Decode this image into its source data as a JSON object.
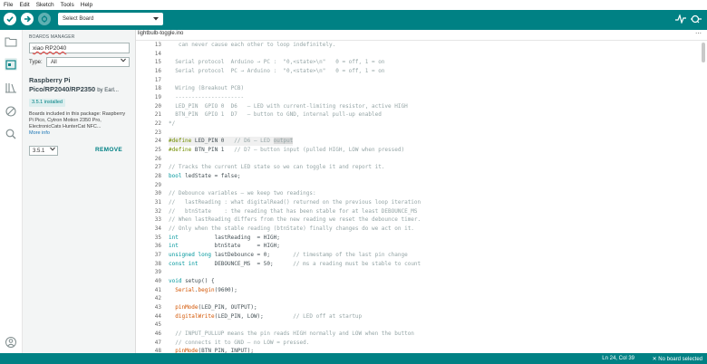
{
  "menu": [
    "File",
    "Edit",
    "Sketch",
    "Tools",
    "Help"
  ],
  "toolbar": {
    "board_select": "Select Board"
  },
  "panel": {
    "title": "BOARDS MANAGER",
    "search_value": "xiao RP2040",
    "type_label": "Type:",
    "type_value": "All",
    "package_title": "Raspberry Pi Pico/RP2040/RP2350",
    "package_by": "by Earl...",
    "installed_badge": "3.5.1 installed",
    "description": "Boards included in this package: Raspberry Pi Pico, Cytron Motion 2350 Pro, ElectronicCats HunterCat NFC...",
    "more_info": "More info",
    "version_value": "3.5.1",
    "remove_label": "REMOVE"
  },
  "editor": {
    "tab_name": "lightbulb-toggle.ino",
    "more_icon": "ellipsis-icon"
  },
  "code_lines": [
    {
      "n": "13",
      "t": "   can never cause each other to loop indefinitely.",
      "c": "comment"
    },
    {
      "n": "14",
      "t": "",
      "c": "comment"
    },
    {
      "n": "15",
      "t": "  Serial protocol  Arduino → PC :  \"0,<state>\\n\"   0 = off, 1 = on",
      "c": "comment"
    },
    {
      "n": "16",
      "t": "  Serial protocol  PC → Arduino :  \"0,<state>\\n\"   0 = off, 1 = on",
      "c": "comment"
    },
    {
      "n": "17",
      "t": "",
      "c": "comment"
    },
    {
      "n": "18",
      "t": "  Wiring (Breakout PCB)",
      "c": "comment"
    },
    {
      "n": "19",
      "t": "  ---------------------",
      "c": "comment"
    },
    {
      "n": "20",
      "t": "  LED_PIN  GPIO 0  D6   – LED with current-limiting resistor, active HIGH",
      "c": "comment"
    },
    {
      "n": "21",
      "t": "  BTN_PIN  GPIO 1  D7   – button to GND, internal pull-up enabled",
      "c": "comment"
    },
    {
      "n": "22",
      "t": "*/",
      "c": "comment"
    },
    {
      "n": "23",
      "t": "",
      "c": ""
    },
    {
      "n": "24",
      "t": "",
      "c": "",
      "pre": "#define",
      "rest": " LED_PIN 0   ",
      "cm": "// D6 – LED ",
      "sel": "output",
      "hl": true
    },
    {
      "n": "25",
      "t": "",
      "c": "",
      "pre": "#define",
      "rest": " BTN_PIN 1   ",
      "cm": "// D7 – button input (pulled HIGH, LOW when pressed)"
    },
    {
      "n": "26",
      "t": "",
      "c": ""
    },
    {
      "n": "27",
      "t": "// Tracks the current LED state so we can toggle it and report it.",
      "c": "comment"
    },
    {
      "n": "28",
      "t": "",
      "c": "",
      "ty": "bool",
      "rest": " ledState = false;"
    },
    {
      "n": "29",
      "t": "",
      "c": ""
    },
    {
      "n": "30",
      "t": "// Debounce variables – we keep two readings:",
      "c": "comment"
    },
    {
      "n": "31",
      "t": "//   lastReading : what digitalRead() returned on the previous loop iteration",
      "c": "comment"
    },
    {
      "n": "32",
      "t": "//   btnState    : the reading that has been stable for at least DEBOUNCE_MS",
      "c": "comment"
    },
    {
      "n": "33",
      "t": "// When lastReading differs from the new reading we reset the debounce timer.",
      "c": "comment"
    },
    {
      "n": "34",
      "t": "// Only when the stable reading (btnState) finally changes do we act on it.",
      "c": "comment"
    },
    {
      "n": "35",
      "t": "",
      "c": "",
      "ty": "int",
      "rest": "           lastReading  = HIGH;"
    },
    {
      "n": "36",
      "t": "",
      "c": "",
      "ty": "int",
      "rest": "           btnState     = HIGH;"
    },
    {
      "n": "37",
      "t": "",
      "c": "",
      "ty": "unsigned long",
      "rest": " lastDebounce = 0;       ",
      "cm": "// timestamp of the last pin change"
    },
    {
      "n": "38",
      "t": "",
      "c": "",
      "ty": "const int",
      "rest": "     DEBOUNCE_MS  = 50;      ",
      "cm": "// ms a reading must be stable to count"
    },
    {
      "n": "39",
      "t": "",
      "c": ""
    },
    {
      "n": "40",
      "t": "",
      "c": "",
      "ty": "void",
      "rest": " setup() {"
    },
    {
      "n": "41",
      "t": "",
      "c": "",
      "ind": "  ",
      "fn": "Serial",
      "rest": ".",
      "fn2": "begin",
      "rest2": "(9600);"
    },
    {
      "n": "42",
      "t": "",
      "c": ""
    },
    {
      "n": "43",
      "t": "",
      "c": "",
      "ind": "  ",
      "fn": "pinMode",
      "rest": "(LED_PIN, OUTPUT);"
    },
    {
      "n": "44",
      "t": "",
      "c": "",
      "ind": "  ",
      "fn": "digitalWrite",
      "rest": "(LED_PIN, LOW);         ",
      "cm": "// LED off at startup"
    },
    {
      "n": "45",
      "t": "",
      "c": ""
    },
    {
      "n": "46",
      "t": "  // INPUT_PULLUP means the pin reads HIGH normally and LOW when the button",
      "c": "comment"
    },
    {
      "n": "47",
      "t": "  // connects it to GND – no LOW = pressed.",
      "c": "comment"
    },
    {
      "n": "48",
      "t": "",
      "c": "",
      "ind": "  ",
      "fn": "pinMode",
      "rest": "(BTN_PIN, INPUT);"
    }
  ],
  "status": {
    "position": "Ln 24, Col 39",
    "board": "No board selected",
    "board_icon": "close-icon"
  }
}
